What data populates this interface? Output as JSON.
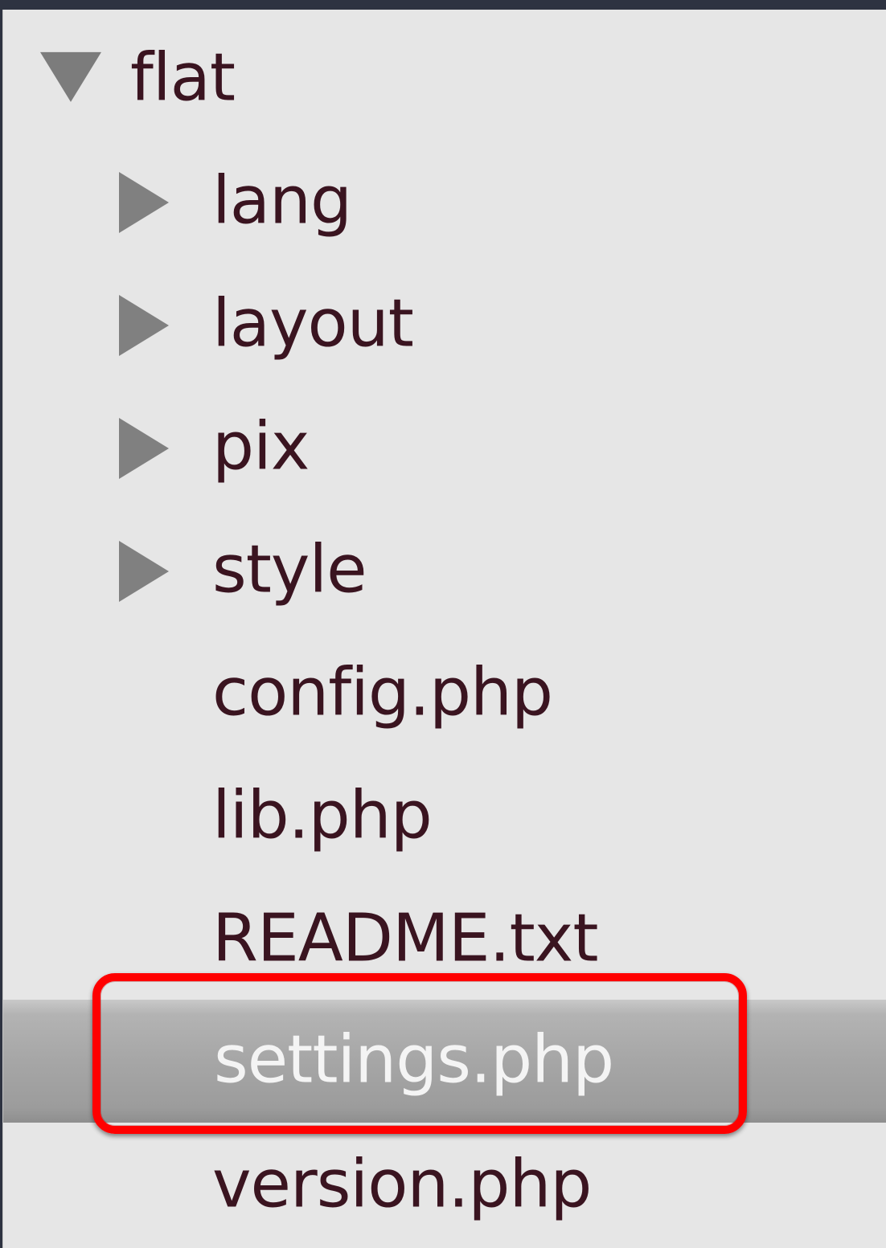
{
  "tree": {
    "root": {
      "label": "flat",
      "expanded": true,
      "icon": "triangle-down-icon"
    },
    "children": [
      {
        "label": "lang",
        "type": "folder",
        "expanded": false,
        "icon": "triangle-right-icon"
      },
      {
        "label": "layout",
        "type": "folder",
        "expanded": false,
        "icon": "triangle-right-icon"
      },
      {
        "label": "pix",
        "type": "folder",
        "expanded": false,
        "icon": "triangle-right-icon"
      },
      {
        "label": "style",
        "type": "folder",
        "expanded": false,
        "icon": "triangle-right-icon"
      },
      {
        "label": "config.php",
        "type": "file"
      },
      {
        "label": "lib.php",
        "type": "file"
      },
      {
        "label": "README.txt",
        "type": "file"
      },
      {
        "label": "settings.php",
        "type": "file",
        "selected": true,
        "highlighted": true
      },
      {
        "label": "version.php",
        "type": "file"
      }
    ]
  },
  "colors": {
    "header_bar": "#2e3341",
    "panel_background": "#e6e6e6",
    "text": "#3a1420",
    "selected_text": "#f4f4f4",
    "selected_row": "#a6a6a6",
    "annotation": "#ff0000"
  }
}
